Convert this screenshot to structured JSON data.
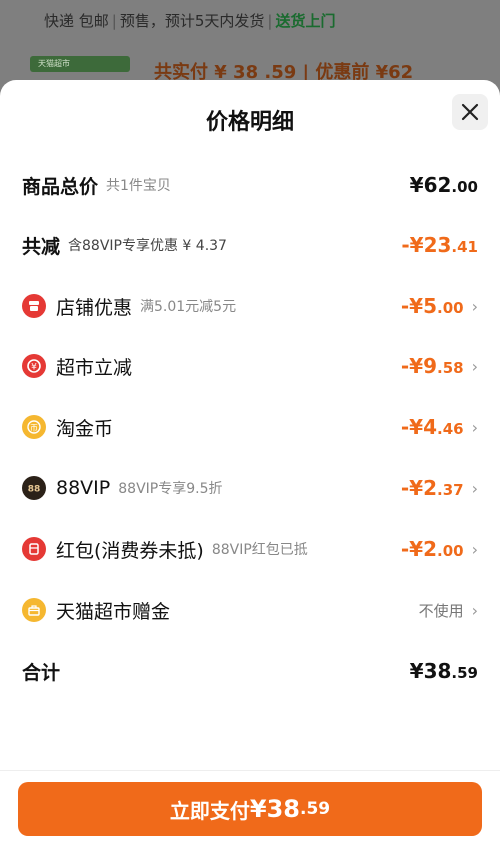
{
  "background": {
    "shipping_text": "快递 包邮",
    "presale_text": "预售，预计5天内发货",
    "delivery_text": "送货上门",
    "banner_text": "天猫超市",
    "price_text": "共实付 ¥ 38 .59 | 优惠前 ¥62"
  },
  "sheet": {
    "title": "价格明细",
    "close_icon": "close-icon"
  },
  "rows": {
    "total": {
      "label": "商品总价",
      "sub": "共1件宝贝",
      "int": "¥62",
      "dec": ".00"
    },
    "discount": {
      "label": "共减",
      "sub": "含88VIP专享优惠 ¥ 4.37",
      "int": "-¥23",
      "dec": ".41"
    },
    "store": {
      "label": "店铺优惠",
      "sub": "满5.01元减5元",
      "int": "-¥5",
      "dec": ".00",
      "icon": "store-icon"
    },
    "market": {
      "label": "超市立减",
      "int": "-¥9",
      "dec": ".58",
      "icon": "yuan-coin-icon"
    },
    "taojin": {
      "label": "淘金币",
      "int": "-¥4",
      "dec": ".46",
      "icon": "coin-icon"
    },
    "vip": {
      "label": "88VIP",
      "sub": "88VIP专享9.5折",
      "int": "-¥2",
      "dec": ".37",
      "icon": "vip88-icon"
    },
    "redpacket": {
      "label": "红包(消费券未抵)",
      "sub": "88VIP红包已抵",
      "int": "-¥2",
      "dec": ".00",
      "icon": "red-packet-icon"
    },
    "gift": {
      "label": "天猫超市赠金",
      "status": "不使用",
      "icon": "gift-icon"
    },
    "sum": {
      "label": "合计",
      "int": "¥38",
      "dec": ".59"
    }
  },
  "pay_button": {
    "label": "立即支付",
    "int": "¥38",
    "dec": ".59"
  },
  "colors": {
    "accent": "#f06a1a",
    "red": "#e53935",
    "gold": "#f5b730"
  }
}
